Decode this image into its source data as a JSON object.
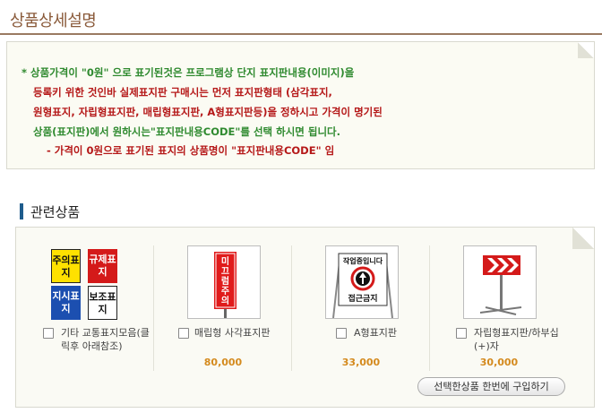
{
  "page": {
    "title": "상품상세설명"
  },
  "notice": {
    "line1": "* 상품가격이 \"0원\" 으로 표기된것은 프로그램상 단지 표지판내용(이미지)을",
    "line2": "등록키 위한 것인바 실제표지판 구매시는 먼저 표지판형태 (삼각표지,",
    "line3": "원형표지, 자립형표지판, 매립형표지판, A형표지판등)을 정하시고 가격이 명기된",
    "line4": "상품(표지판)에서 원하시는\"표지판내용CODE\"를 선택 하시면 됩니다.",
    "line5": "- 가격이 0원으로 표기된 표지의 상품명이 \"표지판내용CODE\" 임"
  },
  "related": {
    "section_title": "관련상품",
    "buy_button_label": "선택한상품 한번에 구입하기",
    "products": [
      {
        "name": "기타 교통표지모음(클릭후 아래참조)",
        "price": "",
        "tiles": [
          "주의표지",
          "규제표지",
          "지시표지",
          "보조표지"
        ]
      },
      {
        "name": "매립형 사각표지판",
        "price": "80,000",
        "sign_text": "미끄럼주의"
      },
      {
        "name": "A형표지판",
        "price": "33,000",
        "sign_top": "작업중입니다",
        "sign_bottom": "접근금지"
      },
      {
        "name": "자립형표지판/하부십(+)자",
        "price": "30,000"
      }
    ]
  },
  "colors": {
    "title": "#8a5a3a",
    "notice_green": "#2f8a2f",
    "notice_red": "#b51818",
    "price": "#d48a1e",
    "section_bar": "#1e5c8c"
  }
}
